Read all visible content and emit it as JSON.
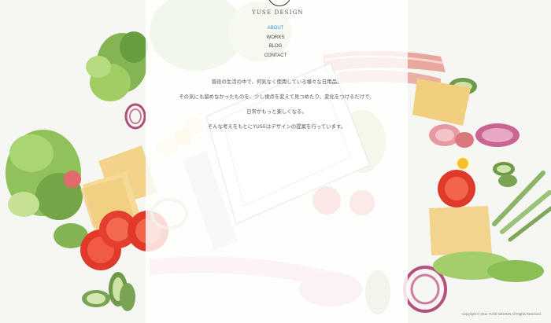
{
  "brand": {
    "name": "YUSE DESIGN"
  },
  "nav": {
    "items": [
      {
        "label": "ABOUT",
        "active": true
      },
      {
        "label": "WORKS",
        "active": false
      },
      {
        "label": "BLOG",
        "active": false
      },
      {
        "label": "CONTACT",
        "active": false
      }
    ]
  },
  "about": {
    "lines": [
      "普段の生活の中で、何気なく使用している様々な日用品。",
      "その気にも留めなかったものを、少し視点を変えて見つめたり、変化をつけるだけで、",
      "日常がもっと楽しくなる。",
      "そんな考えをもとにYUSEはデザインの提案を行っています。"
    ]
  },
  "footer": {
    "copyright": "Copyright © 2011 YUSE DESIGN All Rights Reserved."
  },
  "theme": {
    "accent": "#3a8fd0",
    "text": "#555555",
    "panel": "#ffffff"
  }
}
